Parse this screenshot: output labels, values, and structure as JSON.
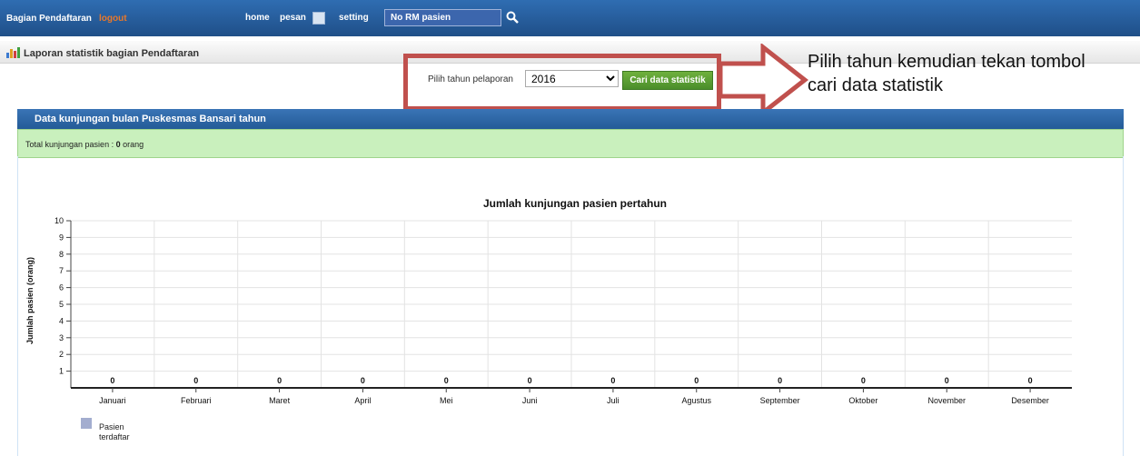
{
  "topbar": {
    "app_title": "Bagian Pendaftaran",
    "logout": "logout",
    "nav": {
      "home": "home",
      "pesan": "pesan",
      "setting": "setting"
    },
    "search_placeholder": "No RM pasien",
    "search_icon": "search-icon",
    "pesan_icon": "message-icon"
  },
  "page": {
    "title": "Laporan statistik bagian Pendaftaran",
    "title_icon": "bar-chart-icon"
  },
  "filter": {
    "label": "Pilih tahun pelaporan",
    "selected_year": "2016",
    "button_label": "Cari data statistik"
  },
  "annotation": {
    "text": "Pilih tahun kemudian tekan tombol cari data statistik",
    "color": "#c0504d"
  },
  "panel": {
    "title": "Data kunjungan bulan Puskesmas Bansari tahun",
    "total_prefix": "Total kunjungan pasien : ",
    "total_value": "0",
    "total_suffix": " orang"
  },
  "chart_data": {
    "type": "bar",
    "title": "Jumlah kunjungan pasien pertahun",
    "xlabel": "",
    "ylabel": "Jumlah pasien (orang)",
    "ylim": [
      0,
      10
    ],
    "yticks": [
      1,
      2,
      3,
      4,
      5,
      6,
      7,
      8,
      9,
      10
    ],
    "categories": [
      "Januari",
      "Februari",
      "Maret",
      "April",
      "Mei",
      "Juni",
      "Juli",
      "Agustus",
      "September",
      "Oktober",
      "November",
      "Desember"
    ],
    "series": [
      {
        "name": "Pasien terdaftar",
        "values": [
          0,
          0,
          0,
          0,
          0,
          0,
          0,
          0,
          0,
          0,
          0,
          0
        ],
        "color": "#a3adcf"
      }
    ],
    "grid": true,
    "legend_placement": "bottom-left"
  }
}
